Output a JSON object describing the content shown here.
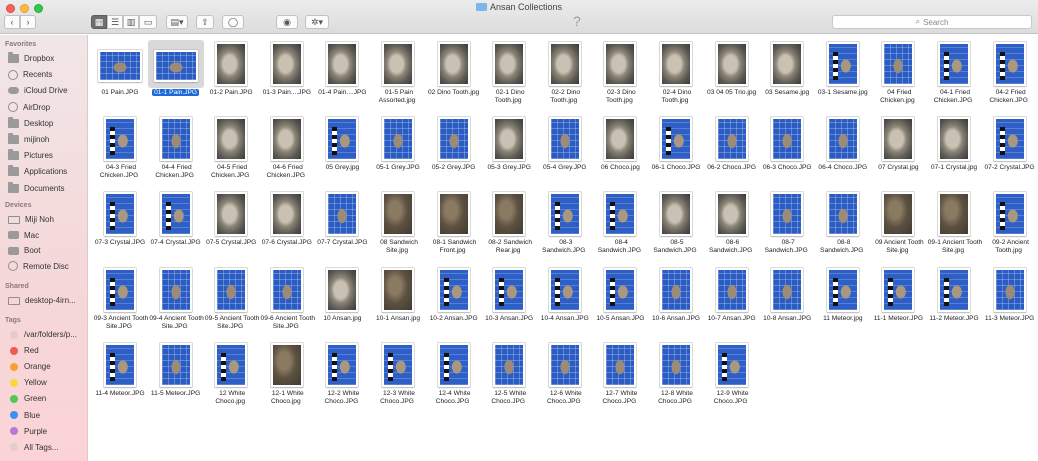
{
  "window": {
    "title": "Ansan Collections"
  },
  "toolbar": {
    "back_glyph": "‹",
    "forward_glyph": "›",
    "view_icon_glyph": "▦",
    "view_list_glyph": "☰",
    "view_column_glyph": "▥",
    "view_gallery_glyph": "▭",
    "group_glyph": "▤▾",
    "share_glyph": "⇪",
    "tag_glyph": "◯",
    "quicklook_glyph": "◉",
    "action_glyph": "✲▾",
    "help_glyph": "?",
    "search_placeholder": "Search",
    "search_glyph": "⌕"
  },
  "sidebar": {
    "favorites_heading": "Favorites",
    "favorites": [
      {
        "label": "Dropbox",
        "icon": "dropbox-icon"
      },
      {
        "label": "Recents",
        "icon": "recents-icon"
      },
      {
        "label": "iCloud Drive",
        "icon": "icloud-icon"
      },
      {
        "label": "AirDrop",
        "icon": "airdrop-icon"
      },
      {
        "label": "Desktop",
        "icon": "desktop-folder-icon"
      },
      {
        "label": "mijinoh",
        "icon": "home-icon"
      },
      {
        "label": "Pictures",
        "icon": "pictures-icon"
      },
      {
        "label": "Applications",
        "icon": "applications-icon"
      },
      {
        "label": "Documents",
        "icon": "documents-icon"
      }
    ],
    "devices_heading": "Devices",
    "devices": [
      {
        "label": "Miji Noh",
        "icon": "computer-icon"
      },
      {
        "label": "Mac",
        "icon": "disk-icon"
      },
      {
        "label": "Boot",
        "icon": "disk-icon"
      },
      {
        "label": "Remote Disc",
        "icon": "remote-disc-icon"
      }
    ],
    "shared_heading": "Shared",
    "shared": [
      {
        "label": "desktop-4irn...",
        "icon": "network-computer-icon"
      }
    ],
    "tags_heading": "Tags",
    "tags": [
      {
        "label": "/var/folders/p...",
        "color": "#e8c8c9"
      },
      {
        "label": "Red",
        "color": "#f25a56"
      },
      {
        "label": "Orange",
        "color": "#f8a131"
      },
      {
        "label": "Yellow",
        "color": "#f9d93a"
      },
      {
        "label": "Green",
        "color": "#52c756"
      },
      {
        "label": "Blue",
        "color": "#3c8ef6"
      },
      {
        "label": "Purple",
        "color": "#b679da"
      },
      {
        "label": "All Tags...",
        "color": "#e3cfd0"
      }
    ]
  },
  "files": [
    {
      "name": "01 Pain.JPG",
      "thumb": "blue"
    },
    {
      "name": "01-1 Pain.JPG",
      "thumb": "blue",
      "selected": true
    },
    {
      "name": "01-2 Pain.JPG",
      "thumb": "rock"
    },
    {
      "name": "01-3 Pain....JPG",
      "thumb": "rock"
    },
    {
      "name": "01-4 Pain....JPG",
      "thumb": "rock"
    },
    {
      "name": "01-5 Pain Assorted.jpg",
      "thumb": "rock"
    },
    {
      "name": "02 Dino Tooth.jpg",
      "thumb": "rock"
    },
    {
      "name": "02-1 Dino Tooth.jpg",
      "thumb": "rock"
    },
    {
      "name": "02-2 Dino Tooth.jpg",
      "thumb": "rock"
    },
    {
      "name": "02-3 Dino Tooth.jpg",
      "thumb": "rock"
    },
    {
      "name": "02-4 Dino Tooth.jpg",
      "thumb": "rock"
    },
    {
      "name": "03 04 05 Trio.jpg",
      "thumb": "rock"
    },
    {
      "name": "03 Sesame.jpg",
      "thumb": "rock"
    },
    {
      "name": "03-1 Sesame.jpg",
      "thumb": "scale"
    },
    {
      "name": "04 Fried Chicken.jpg",
      "thumb": "blue"
    },
    {
      "name": "04-1 Fried Chicken.JPG",
      "thumb": "scale"
    },
    {
      "name": "04-2 Fried Chicken.JPG",
      "thumb": "scale"
    },
    {
      "name": "04-3 Fried Chicken.JPG",
      "thumb": "scale"
    },
    {
      "name": "04-4 Fried Chicken.JPG",
      "thumb": "blue"
    },
    {
      "name": "04-5 Fried Chicken.JPG",
      "thumb": "rock"
    },
    {
      "name": "04-6 Fried Chicken.JPG",
      "thumb": "rock"
    },
    {
      "name": "05 Grey.jpg",
      "thumb": "scale"
    },
    {
      "name": "05-1 Grey.JPG",
      "thumb": "blue"
    },
    {
      "name": "05-2 Grey.JPG",
      "thumb": "blue"
    },
    {
      "name": "05-3 Grey.JPG",
      "thumb": "rock"
    },
    {
      "name": "05-4 Grey.JPG",
      "thumb": "blue"
    },
    {
      "name": "06 Choco.jpg",
      "thumb": "rock"
    },
    {
      "name": "06-1 Choco.JPG",
      "thumb": "scale"
    },
    {
      "name": "06-2 Choco.JPG",
      "thumb": "blue"
    },
    {
      "name": "06-3 Choco.JPG",
      "thumb": "blue"
    },
    {
      "name": "06-4 Choco.JPG",
      "thumb": "blue"
    },
    {
      "name": "07 Crystal.jpg",
      "thumb": "rock"
    },
    {
      "name": "07-1 Crystal.jpg",
      "thumb": "rock"
    },
    {
      "name": "07-2 Crystal.JPG",
      "thumb": "scale"
    },
    {
      "name": "07-3 Crystal.JPG",
      "thumb": "scale"
    },
    {
      "name": "07-4 Crystal.JPG",
      "thumb": "scale"
    },
    {
      "name": "07-5 Crystal.JPG",
      "thumb": "rock"
    },
    {
      "name": "07-6 Crystal.JPG",
      "thumb": "rock"
    },
    {
      "name": "07-7 Crystal.JPG",
      "thumb": "blue"
    },
    {
      "name": "08 Sandwich Site.jpg",
      "thumb": "dirt"
    },
    {
      "name": "08-1 Sandwich Front.jpg",
      "thumb": "dirt"
    },
    {
      "name": "08-2 Sandwich Rear.jpg",
      "thumb": "dirt"
    },
    {
      "name": "08-3 Sandwich.JPG",
      "thumb": "scale"
    },
    {
      "name": "08-4 Sandwich.JPG",
      "thumb": "scale"
    },
    {
      "name": "08-5 Sandwich.JPG",
      "thumb": "rock"
    },
    {
      "name": "08-6 Sandwich.JPG",
      "thumb": "rock"
    },
    {
      "name": "08-7 Sandwich.JPG",
      "thumb": "blue"
    },
    {
      "name": "08-8 Sandwich.JPG",
      "thumb": "blue"
    },
    {
      "name": "09 Ancient Tooth Site.jpg",
      "thumb": "dirt"
    },
    {
      "name": "09-1 Ancient Tooth Site.jpg",
      "thumb": "dirt"
    },
    {
      "name": "09-2 Ancient Tooth.jpg",
      "thumb": "scale"
    },
    {
      "name": "09-3 Ancient Tooth Site.JPG",
      "thumb": "scale"
    },
    {
      "name": "09-4 Ancient Tooth Site.JPG",
      "thumb": "blue"
    },
    {
      "name": "09-5 Ancient Tooth Site.JPG",
      "thumb": "blue"
    },
    {
      "name": "09-6 Ancient Tooth Site.JPG",
      "thumb": "blue"
    },
    {
      "name": "10 Ansan.jpg",
      "thumb": "rock"
    },
    {
      "name": "10-1 Ansan.jpg",
      "thumb": "dirt"
    },
    {
      "name": "10-2 Ansan.JPG",
      "thumb": "scale"
    },
    {
      "name": "10-3 Ansan.JPG",
      "thumb": "scale"
    },
    {
      "name": "10-4 Ansan.JPG",
      "thumb": "scale"
    },
    {
      "name": "10-5 Ansan.JPG",
      "thumb": "scale"
    },
    {
      "name": "10-6 Ansan.JPG",
      "thumb": "blue"
    },
    {
      "name": "10-7 Ansan.JPG",
      "thumb": "blue"
    },
    {
      "name": "10-8 Ansan.JPG",
      "thumb": "blue"
    },
    {
      "name": "11 Meteor.jpg",
      "thumb": "scale"
    },
    {
      "name": "11-1 Meteor.JPG",
      "thumb": "scale"
    },
    {
      "name": "11-2 Meteor.JPG",
      "thumb": "scale"
    },
    {
      "name": "11-3 Meteor.JPG",
      "thumb": "blue"
    },
    {
      "name": "11-4 Meteor.JPG",
      "thumb": "scale"
    },
    {
      "name": "11-5 Meteor.JPG",
      "thumb": "blue"
    },
    {
      "name": "12 White Choco.jpg",
      "thumb": "scale"
    },
    {
      "name": "12-1 White Choco.jpg",
      "thumb": "dirt"
    },
    {
      "name": "12-2 White Choco.JPG",
      "thumb": "scale"
    },
    {
      "name": "12-3 White Choco.JPG",
      "thumb": "scale"
    },
    {
      "name": "12-4 White Choco.JPG",
      "thumb": "scale"
    },
    {
      "name": "12-5 White Choco.JPG",
      "thumb": "blue"
    },
    {
      "name": "12-6 White Choco.JPG",
      "thumb": "blue"
    },
    {
      "name": "12-7 White Choco.JPG",
      "thumb": "blue"
    },
    {
      "name": "12-8 White Choco.JPG",
      "thumb": "blue"
    },
    {
      "name": "12-9 White Choco.JPG",
      "thumb": "scale"
    }
  ]
}
